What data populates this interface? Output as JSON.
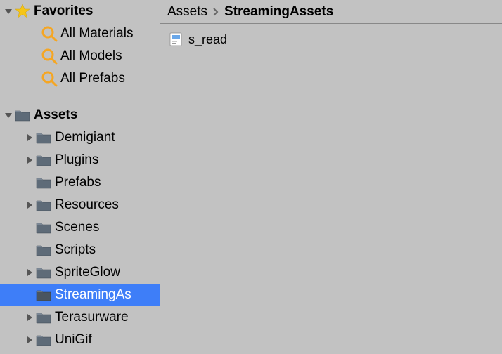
{
  "sidebar": {
    "favorites": {
      "label": "Favorites",
      "items": [
        {
          "label": "All Materials"
        },
        {
          "label": "All Models"
        },
        {
          "label": "All Prefabs"
        }
      ]
    },
    "assets": {
      "label": "Assets",
      "items": [
        {
          "label": "Demigiant",
          "expandable": true
        },
        {
          "label": "Plugins",
          "expandable": true
        },
        {
          "label": "Prefabs",
          "expandable": false
        },
        {
          "label": "Resources",
          "expandable": true
        },
        {
          "label": "Scenes",
          "expandable": false
        },
        {
          "label": "Scripts",
          "expandable": false
        },
        {
          "label": "SpriteGlow",
          "expandable": true
        },
        {
          "label": "StreamingAssets",
          "expandable": false,
          "selected": true,
          "display": "StreamingAs"
        },
        {
          "label": "Terasurware",
          "expandable": true
        },
        {
          "label": "UniGif",
          "expandable": true
        }
      ]
    }
  },
  "breadcrumb": {
    "items": [
      {
        "label": "Assets"
      },
      {
        "label": "StreamingAssets",
        "active": true
      }
    ]
  },
  "content": {
    "files": [
      {
        "label": "s_read"
      }
    ]
  }
}
